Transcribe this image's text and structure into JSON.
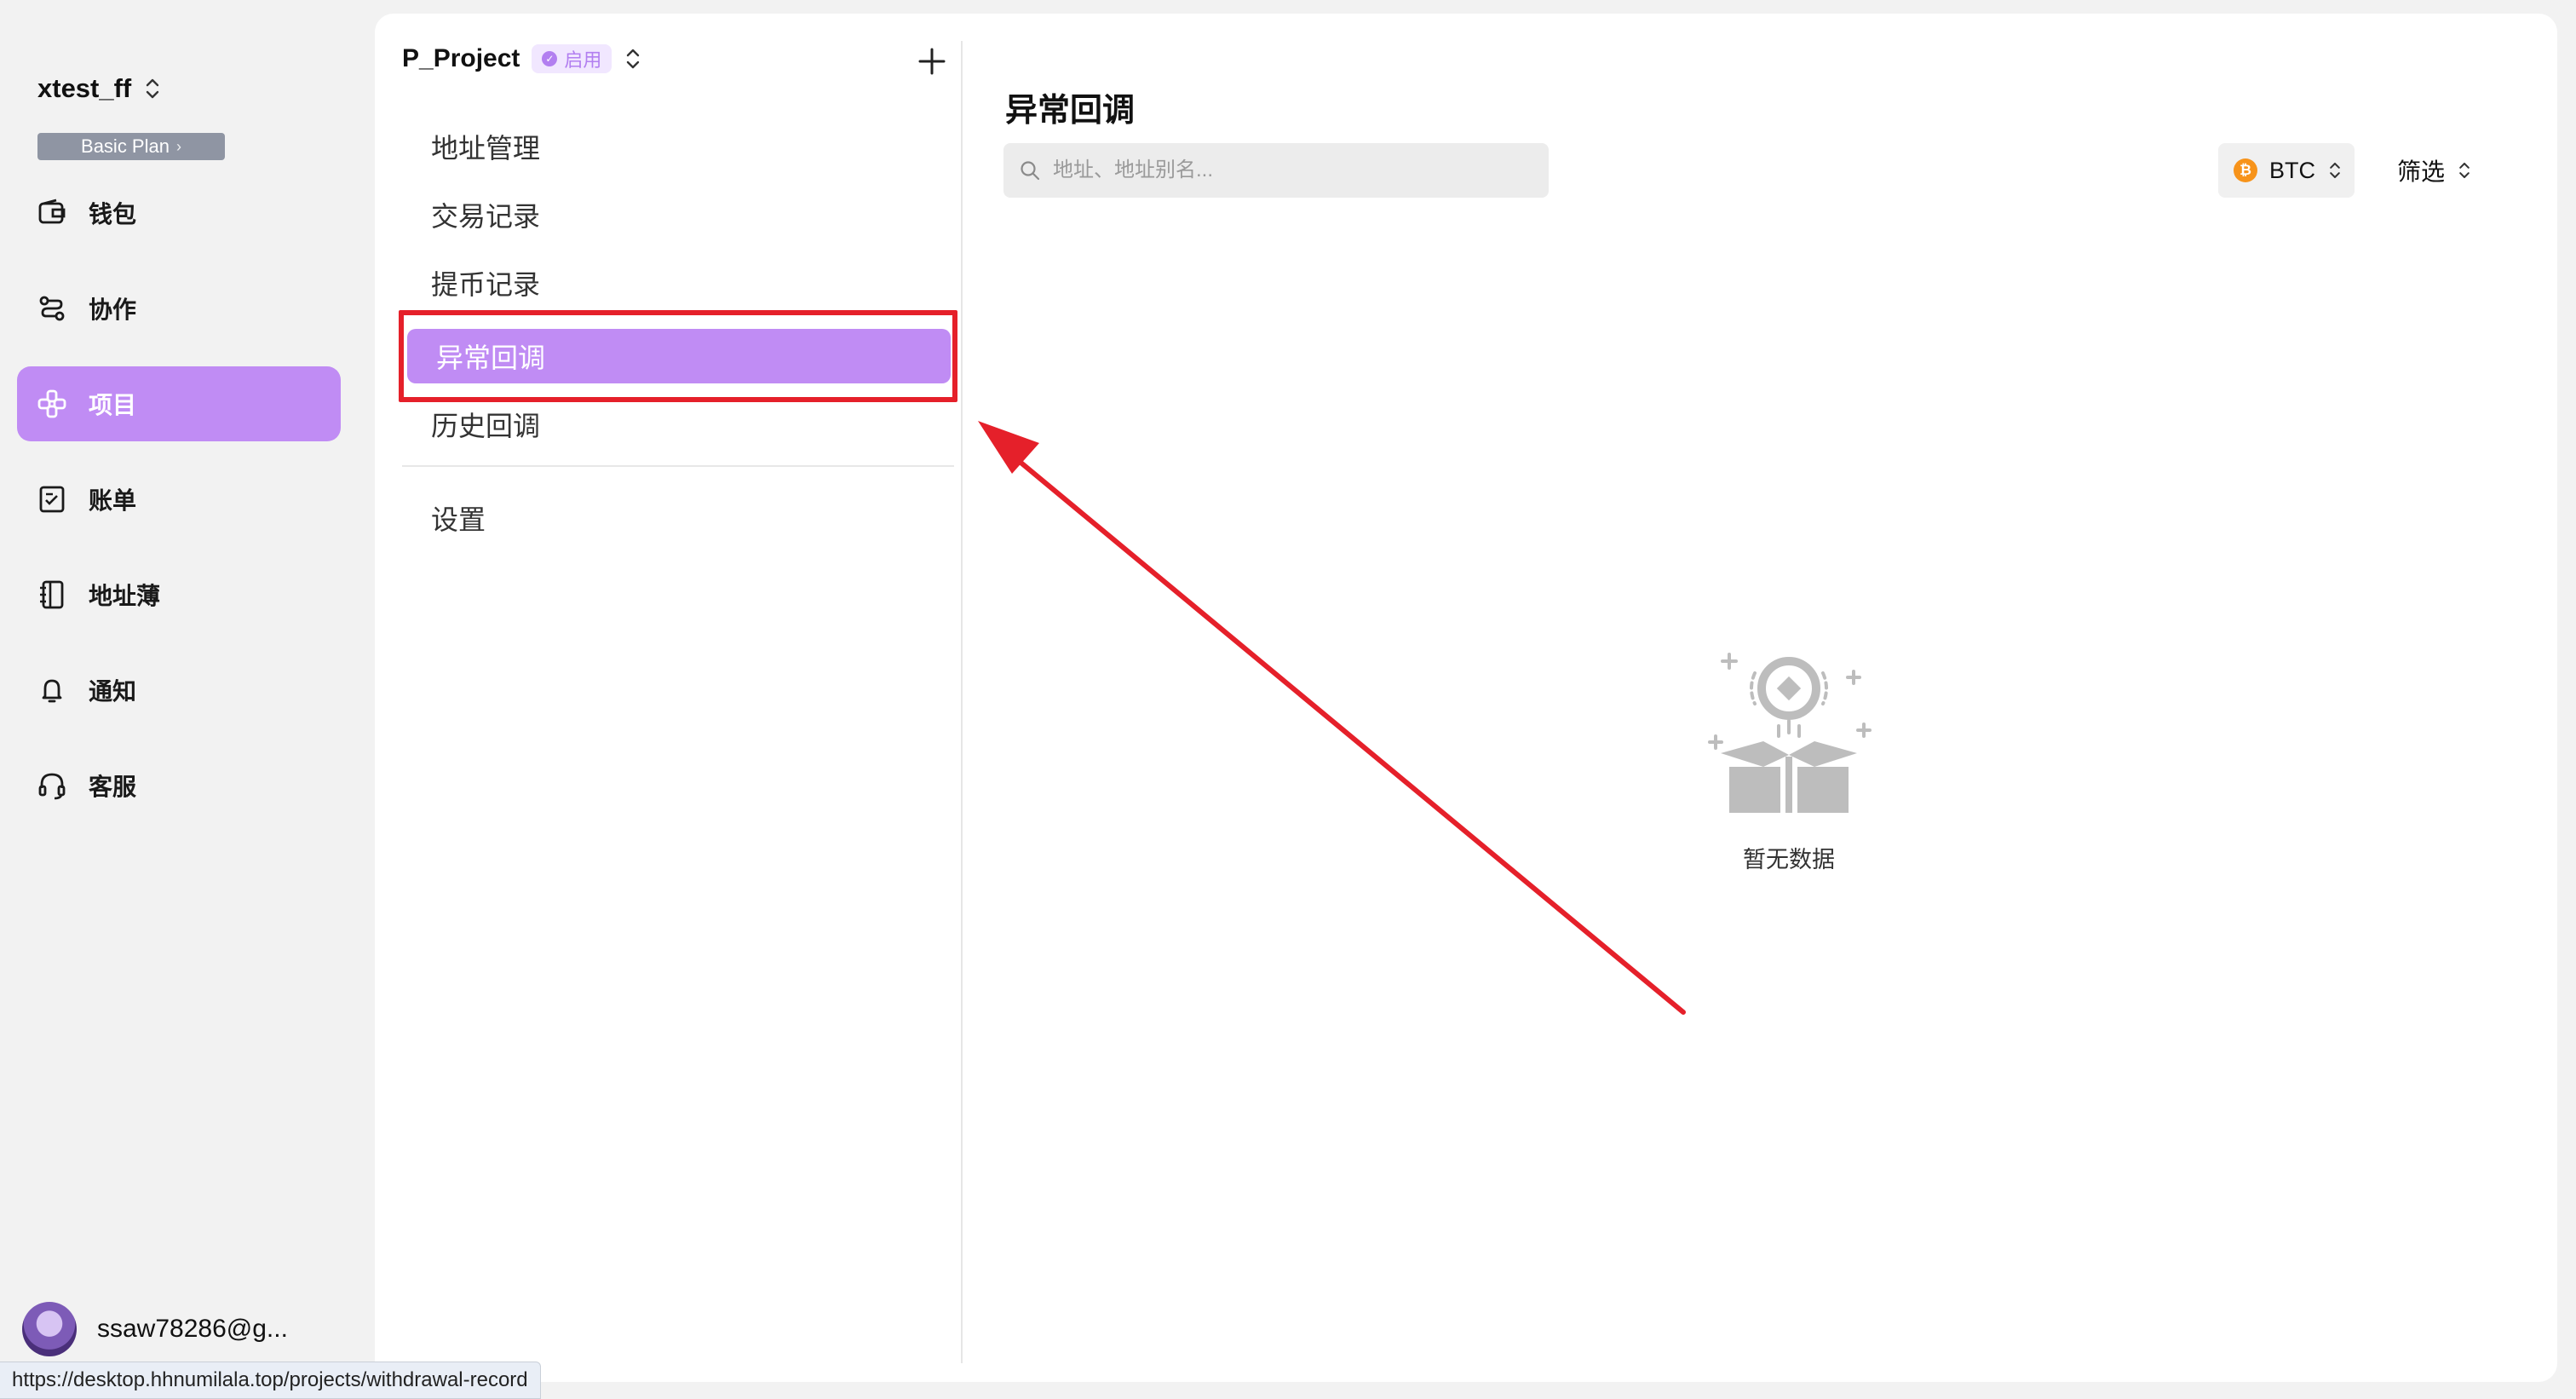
{
  "workspace": {
    "name": "xtest_ff",
    "plan": "Basic Plan"
  },
  "sidebar": {
    "items": [
      {
        "label": "钱包",
        "icon": "wallet-icon"
      },
      {
        "label": "协作",
        "icon": "collaboration-icon"
      },
      {
        "label": "项目",
        "icon": "project-icon",
        "active": true
      },
      {
        "label": "账单",
        "icon": "bill-icon"
      },
      {
        "label": "地址薄",
        "icon": "addressbook-icon"
      },
      {
        "label": "通知",
        "icon": "bell-icon"
      },
      {
        "label": "客服",
        "icon": "headset-icon"
      }
    ]
  },
  "user": {
    "name": "ssaw78286@g..."
  },
  "status_bar": {
    "url": "https://desktop.hhnumilala.top/projects/withdrawal-record"
  },
  "project": {
    "name": "P_Project",
    "status": "启用",
    "menu": [
      {
        "label": "地址管理"
      },
      {
        "label": "交易记录"
      },
      {
        "label": "提币记录"
      },
      {
        "label": "异常回调",
        "active": true
      },
      {
        "label": "历史回调"
      }
    ],
    "settings_label": "设置"
  },
  "main": {
    "title": "异常回调",
    "search_placeholder": "地址、地址别名...",
    "coin": "BTC",
    "filter_label": "筛选",
    "empty_text": "暂无数据"
  },
  "colors": {
    "accent": "#c08cf4",
    "annotation": "#e5202a",
    "btc": "#f7931a"
  }
}
